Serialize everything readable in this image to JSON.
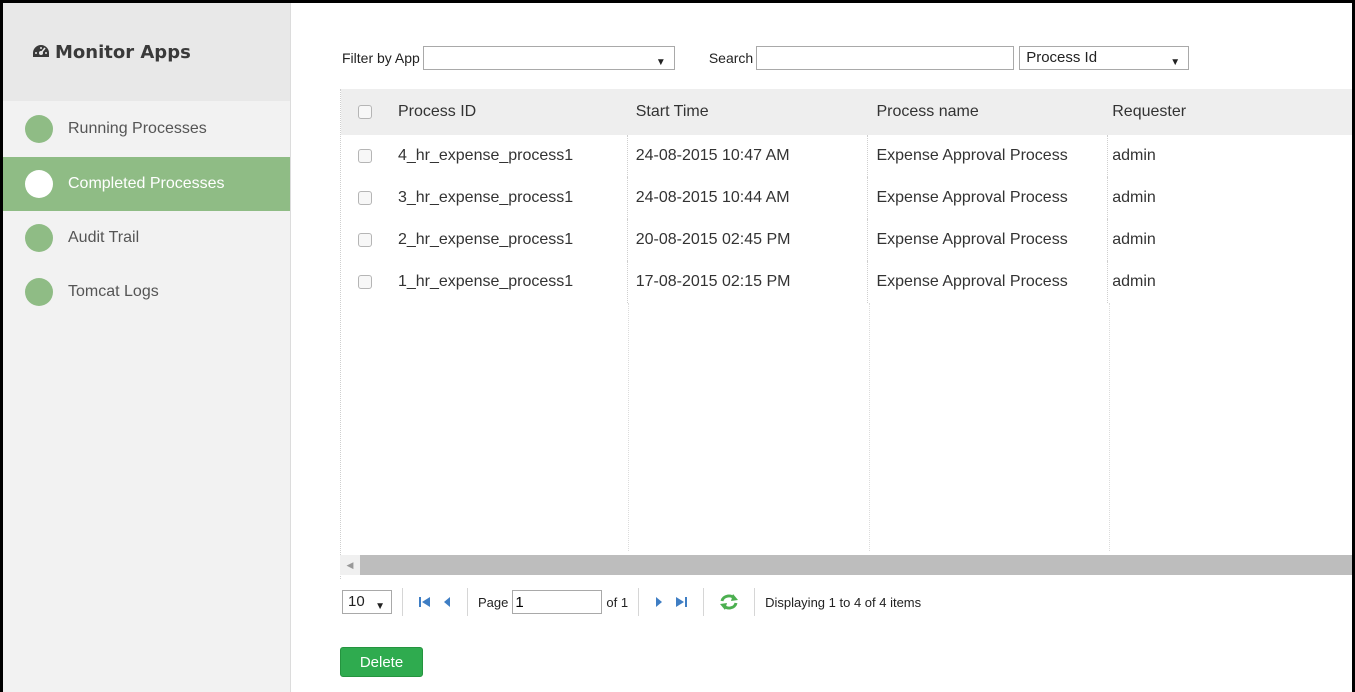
{
  "sidebar": {
    "title": "Monitor Apps",
    "title_icon": "dashboard-icon",
    "items": [
      {
        "label": "Running Processes",
        "active": false
      },
      {
        "label": "Completed Processes",
        "active": true
      },
      {
        "label": "Audit Trail",
        "active": false
      },
      {
        "label": "Tomcat Logs",
        "active": false
      }
    ],
    "accent_color": "#8fbc85"
  },
  "toolbar": {
    "filter_label": "Filter by App",
    "filter_value": "",
    "search_label": "Search",
    "search_value": "",
    "search_field_value": "Process Id"
  },
  "grid": {
    "columns": [
      "Process ID",
      "Start Time",
      "Process name",
      "Requester"
    ],
    "rows": [
      {
        "id": "4_hr_expense_process1",
        "start": "24-08-2015 10:47 AM",
        "name": "Expense Approval Process",
        "requester": "admin"
      },
      {
        "id": "3_hr_expense_process1",
        "start": "24-08-2015 10:44 AM",
        "name": "Expense Approval Process",
        "requester": "admin"
      },
      {
        "id": "2_hr_expense_process1",
        "start": "20-08-2015 02:45 PM",
        "name": "Expense Approval Process",
        "requester": "admin"
      },
      {
        "id": "1_hr_expense_process1",
        "start": "17-08-2015 02:15 PM",
        "name": "Expense Approval Process",
        "requester": "admin"
      }
    ]
  },
  "pager": {
    "page_size": "10",
    "page_label": "Page",
    "page_value": "1",
    "of_label": "of 1",
    "status": "Displaying 1 to 4 of 4 items"
  },
  "actions": {
    "delete_label": "Delete",
    "delete_color": "#2fab4f"
  }
}
